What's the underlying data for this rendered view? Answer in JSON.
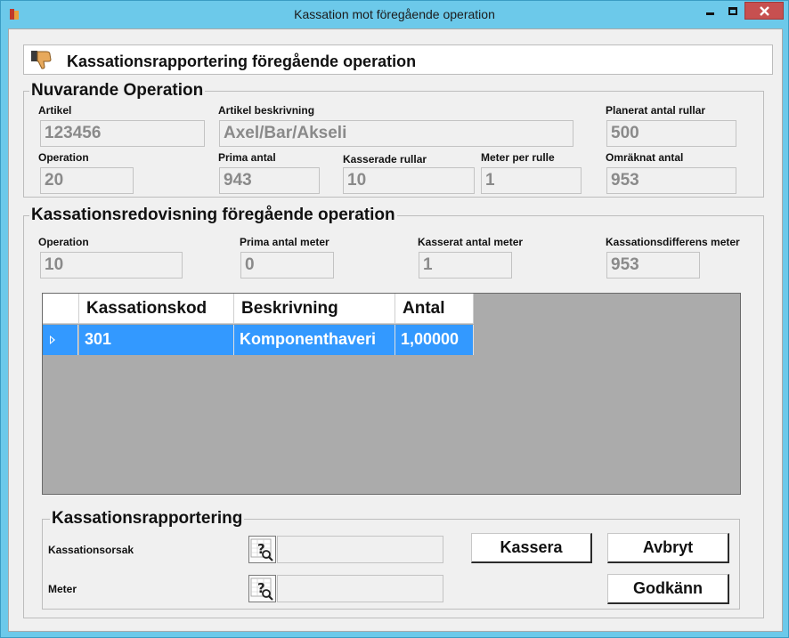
{
  "window": {
    "title": "Kassation mot föregående operation"
  },
  "header": {
    "title": "Kassationsrapportering föregående operation",
    "icon": "thumbs-down-icon"
  },
  "current_operation": {
    "group_title": "Nuvarande Operation",
    "artikel_label": "Artikel",
    "artikel_value": "123456",
    "beskrivning_label": "Artikel beskrivning",
    "beskrivning_value": "Axel/Bar/Akseli",
    "planerat_label": "Planerat antal rullar",
    "planerat_value": "500",
    "operation_label": "Operation",
    "operation_value": "20",
    "prima_label": "Prima antal",
    "prima_value": "943",
    "kasserade_label": "Kasserade rullar",
    "kasserade_value": "10",
    "meter_label": "Meter per rulle",
    "meter_value": "1",
    "omraknat_label": "Omräknat antal",
    "omraknat_value": "953"
  },
  "previous_operation": {
    "group_title": "Kassationsredovisning föregående operation",
    "operation_label": "Operation",
    "operation_value": "10",
    "prima_label": "Prima antal meter",
    "prima_value": "0",
    "kasserat_label": "Kasserat antal meter",
    "kasserat_value": "1",
    "diff_label": "Kassationsdifferens meter",
    "diff_value": "953"
  },
  "grid": {
    "columns": [
      "Kassationskod",
      "Beskrivning",
      "Antal"
    ],
    "rows": [
      {
        "kod": "301",
        "beskrivning": "Komponenthaveri",
        "antal": "1,00000"
      }
    ]
  },
  "reporting": {
    "group_title": "Kassationsrapportering",
    "orsak_label": "Kassationsorsak",
    "orsak_value": "",
    "meter_label": "Meter",
    "meter_value": "",
    "kassera_button": "Kassera",
    "avbryt_button": "Avbryt",
    "godkann_button": "Godkänn"
  },
  "colors": {
    "title_bar": "#6cc9ea",
    "selection": "#3399ff",
    "grid_background": "#ababab",
    "close_button": "#c75050"
  }
}
